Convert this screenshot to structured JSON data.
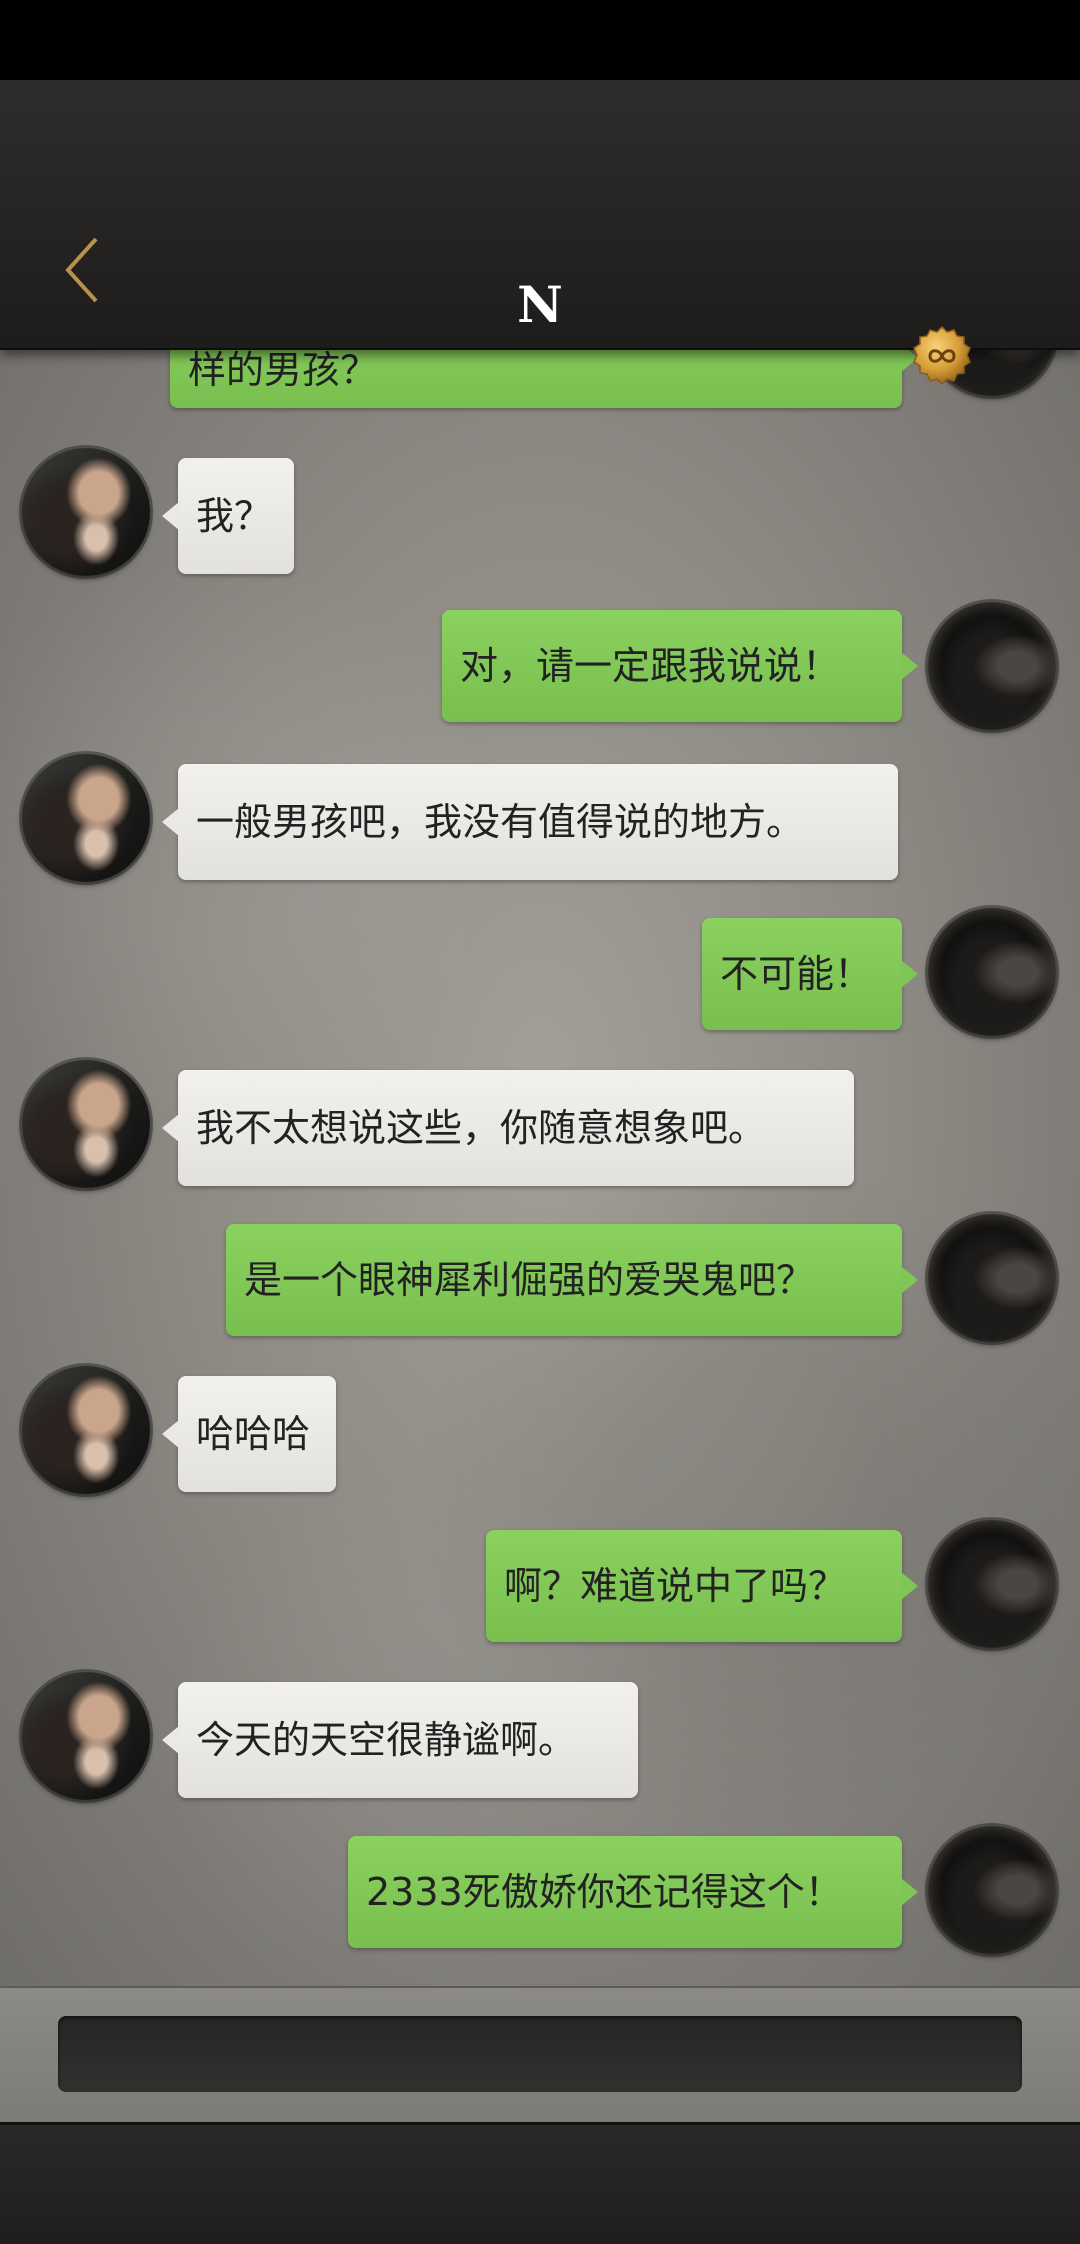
{
  "header": {
    "title": "N",
    "back_icon": "chevron-left-icon",
    "coin_icon": "infinity-coin-icon",
    "accent_color": "#b8914a"
  },
  "chat": {
    "partial_top_message": "样的男孩？",
    "messages": [
      {
        "side": "left",
        "text": "我？"
      },
      {
        "side": "right",
        "text": "对，请一定跟我说说！"
      },
      {
        "side": "left",
        "text": "一般男孩吧，我没有值得说的地方。"
      },
      {
        "side": "right",
        "text": "不可能！"
      },
      {
        "side": "left",
        "text": "我不太想说这些，你随意想象吧。"
      },
      {
        "side": "right",
        "text": "是一个眼神犀利倔强的爱哭鬼吧？"
      },
      {
        "side": "left",
        "text": "哈哈哈"
      },
      {
        "side": "right",
        "text": "啊？难道说中了吗？"
      },
      {
        "side": "left",
        "text": "今天的天空很静谧啊。"
      },
      {
        "side": "right",
        "text": "2333死傲娇你还记得这个！"
      }
    ],
    "colors": {
      "incoming_bubble": "#ebe9e6",
      "outgoing_bubble": "#80c656"
    }
  },
  "input": {
    "value": ""
  }
}
